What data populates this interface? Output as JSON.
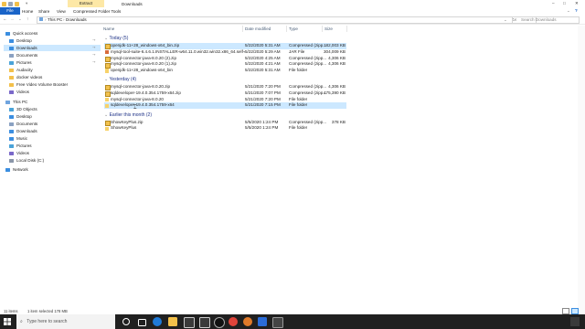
{
  "window": {
    "title": "Downloads",
    "context_tab": "Extract"
  },
  "ribbon": {
    "file": "File",
    "tabs": [
      "Home",
      "Share",
      "View"
    ],
    "context_subtab": "Compressed Folder Tools"
  },
  "address": {
    "path": [
      "This PC",
      "Downloads"
    ],
    "search_placeholder": "Search Downloads"
  },
  "nav": {
    "quick_access": "Quick access",
    "items": [
      {
        "label": "Desktop",
        "icon": "desktop-icon",
        "pinned": true
      },
      {
        "label": "Downloads",
        "icon": "download-icon",
        "pinned": true,
        "selected": true
      },
      {
        "label": "Documents",
        "icon": "document-icon",
        "pinned": true
      },
      {
        "label": "Pictures",
        "icon": "pictures-icon",
        "pinned": true
      },
      {
        "label": "Audacity",
        "icon": "folder-icon"
      },
      {
        "label": "docker videos",
        "icon": "folder-icon"
      },
      {
        "label": "Free Video Volume Booster",
        "icon": "folder-icon"
      },
      {
        "label": "Videos",
        "icon": "videos-icon"
      }
    ],
    "this_pc": "This PC",
    "pc_items": [
      {
        "label": "3D Objects",
        "icon": "cube-icon"
      },
      {
        "label": "Desktop",
        "icon": "desktop-icon"
      },
      {
        "label": "Documents",
        "icon": "document-icon"
      },
      {
        "label": "Downloads",
        "icon": "download-icon"
      },
      {
        "label": "Music",
        "icon": "music-icon"
      },
      {
        "label": "Pictures",
        "icon": "pictures-icon"
      },
      {
        "label": "Videos",
        "icon": "videos-icon"
      },
      {
        "label": "Local Disk (C:)",
        "icon": "drive-icon"
      }
    ],
    "network": "Network"
  },
  "columns": {
    "name": "Name",
    "date": "Date modified",
    "type": "Type",
    "size": "Size"
  },
  "groups": [
    {
      "label": "Today (5)",
      "rows": [
        {
          "name": "openjdk-11+28_windows-x64_bin.zip",
          "date": "5/22/2020 5:31 AM",
          "type": "Compressed (zipp...",
          "size": "182,003 KB",
          "icon": "zip",
          "highlight": true
        },
        {
          "name": "mysql-tool-suite-6.4.6.1.INSTALLER-w64.11.0.win32.win32.x86_64.self-extracting.jar",
          "date": "5/22/2020 5:29 AM",
          "type": "JAR File",
          "size": "304,009 KB",
          "icon": "jar"
        },
        {
          "name": "mysql-connector-java-8.0.20 (2).zip",
          "date": "5/22/2020 4:25 AM",
          "type": "Compressed (zipp...",
          "size": "4,306 KB",
          "icon": "zip"
        },
        {
          "name": "mysql-connector-java-8.0.20 (1).zip",
          "date": "5/22/2020 4:21 AM",
          "type": "Compressed (zipp...",
          "size": "4,306 KB",
          "icon": "zip"
        },
        {
          "name": "openjdk-11+28_windows-x64_bin",
          "date": "5/22/2020 5:31 AM",
          "type": "File folder",
          "size": "",
          "icon": "folder"
        }
      ]
    },
    {
      "label": "Yesterday (4)",
      "rows": [
        {
          "name": "mysql-connector-java-8.0.20.zip",
          "date": "5/21/2020 7:20 PM",
          "type": "Compressed (zipp...",
          "size": "4,306 KB",
          "icon": "zip"
        },
        {
          "name": "sqldeveloper-19.4.0.354.1759-x64.zip",
          "date": "5/21/2020 7:07 PM",
          "type": "Compressed (zipp...",
          "size": "475,390 KB",
          "icon": "zip"
        },
        {
          "name": "mysql-connector-java-8.0.20",
          "date": "5/21/2020 7:20 PM",
          "type": "File folder",
          "size": "",
          "icon": "folder"
        },
        {
          "name": "sqldeveloper-19.4.0.354.1759-x64",
          "date": "5/21/2020 7:15 PM",
          "type": "File folder",
          "size": "",
          "icon": "folder",
          "highlight": true
        }
      ]
    },
    {
      "label": "Earlier this month (2)",
      "rows": [
        {
          "name": "ShowKeyPlus.zip",
          "date": "5/5/2020 1:24 PM",
          "type": "Compressed (zipp...",
          "size": "378 KB",
          "icon": "zip"
        },
        {
          "name": "ShowKeyPlus",
          "date": "5/5/2020 1:24 PM",
          "type": "File folder",
          "size": "",
          "icon": "folder"
        }
      ]
    }
  ],
  "status": {
    "count": "11 items",
    "selected": "1 item selected  178 MB"
  },
  "taskbar": {
    "search_placeholder": "Type here to search"
  }
}
